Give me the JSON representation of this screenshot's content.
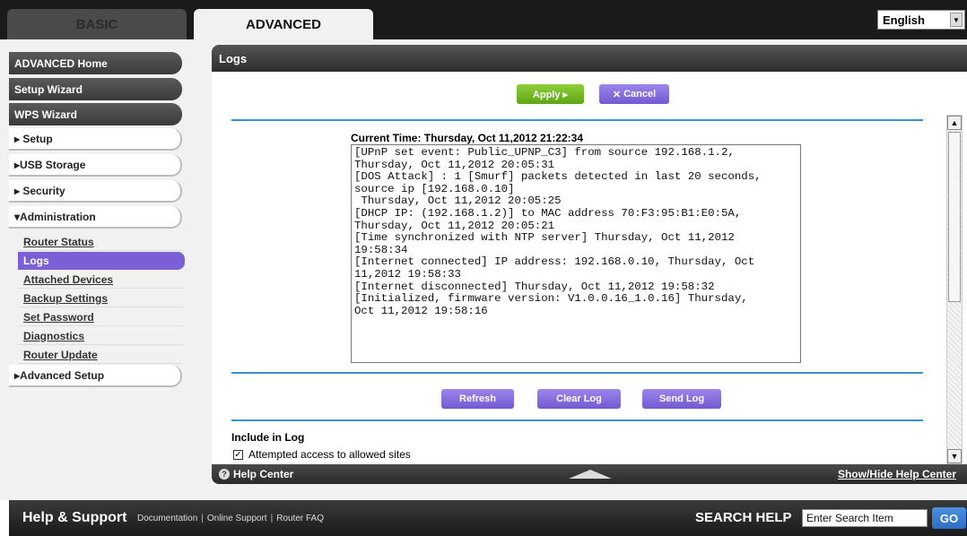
{
  "tabs": {
    "basic": "BASIC",
    "advanced": "ADVANCED"
  },
  "language": {
    "selected": "English"
  },
  "sidebar": {
    "items": [
      {
        "label": "ADVANCED Home"
      },
      {
        "label": "Setup Wizard"
      },
      {
        "label": "WPS Wizard"
      },
      {
        "label": "▸ Setup"
      },
      {
        "label": "▸USB Storage"
      },
      {
        "label": "▸ Security"
      },
      {
        "label": "▾Administration"
      }
    ],
    "admin_sub": [
      {
        "label": "Router Status"
      },
      {
        "label": "Logs"
      },
      {
        "label": "Attached Devices"
      },
      {
        "label": "Backup Settings"
      },
      {
        "label": "Set Password"
      },
      {
        "label": "Diagnostics"
      },
      {
        "label": "Router Update"
      }
    ],
    "advanced_setup": "▸Advanced Setup"
  },
  "panel": {
    "title": "Logs",
    "apply_label": "Apply ▸",
    "cancel_label": "Cancel",
    "current_time": "Current Time: Thursday, Oct 11,2012 21:22:34",
    "log_text": "[UPnP set event: Public_UPNP_C3] from source 192.168.1.2,\nThursday, Oct 11,2012 20:05:31\n[DOS Attack] : 1 [Smurf] packets detected in last 20 seconds,\nsource ip [192.168.0.10]\n Thursday, Oct 11,2012 20:05:25\n[DHCP IP: (192.168.1.2)] to MAC address 70:F3:95:B1:E0:5A,\nThursday, Oct 11,2012 20:05:21\n[Time synchronized with NTP server] Thursday, Oct 11,2012\n19:58:34\n[Internet connected] IP address: 192.168.0.10, Thursday, Oct\n11,2012 19:58:33\n[Internet disconnected] Thursday, Oct 11,2012 19:58:32\n[Initialized, firmware version: V1.0.0.16_1.0.16] Thursday,\nOct 11,2012 19:58:16",
    "refresh_label": "Refresh",
    "clear_log_label": "Clear Log",
    "send_log_label": "Send Log",
    "include_heading": "Include in Log",
    "include_items": [
      {
        "label": "Attempted access to allowed sites",
        "checked": true
      }
    ]
  },
  "help_bar": {
    "help_center": "Help Center",
    "show_hide": "Show/Hide Help Center"
  },
  "footer": {
    "title": "Help & Support",
    "links": [
      "Documentation",
      "Online Support",
      "Router FAQ"
    ],
    "search_label": "SEARCH HELP",
    "search_value": "Enter Search Item",
    "go_label": "GO"
  }
}
